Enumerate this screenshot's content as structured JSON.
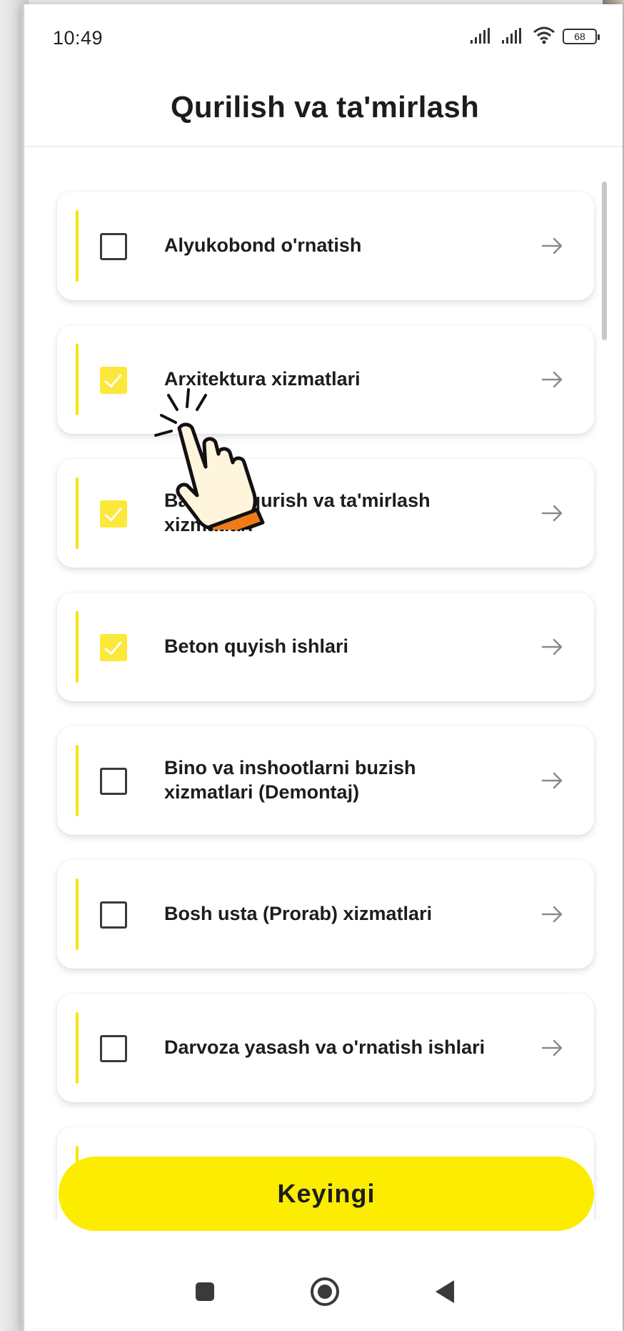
{
  "status_bar": {
    "time": "10:49",
    "battery": "68"
  },
  "header": {
    "title": "Qurilish va ta'mirlash"
  },
  "services": [
    {
      "label": "Alyukobond o'rnatish",
      "checked": false
    },
    {
      "label": "Arxitektura xizmatlari",
      "checked": true
    },
    {
      "label": "Basseyn qurish va ta'mirlash xizmatlari",
      "checked": true
    },
    {
      "label": "Beton quyish ishlari",
      "checked": true
    },
    {
      "label": "Bino va inshootlarni buzish xizmatlari (Demontaj)",
      "checked": false
    },
    {
      "label": "Bosh usta (Prorab) xizmatlari",
      "checked": false
    },
    {
      "label": "Darvoza yasash va o'rnatish ishlari",
      "checked": false
    },
    {
      "label": "",
      "checked": false
    }
  ],
  "next_button": {
    "label": "Keyingi"
  },
  "colors": {
    "accent": "#fbec00",
    "checkbox_checked": "#fbe83a",
    "card_line": "#f5e400"
  },
  "icons": {
    "arrow": "arrow-right-icon",
    "tap_hint": "tap-hand-icon",
    "nav_recent": "square-icon",
    "nav_home": "circle-icon",
    "nav_back": "triangle-back-icon"
  }
}
